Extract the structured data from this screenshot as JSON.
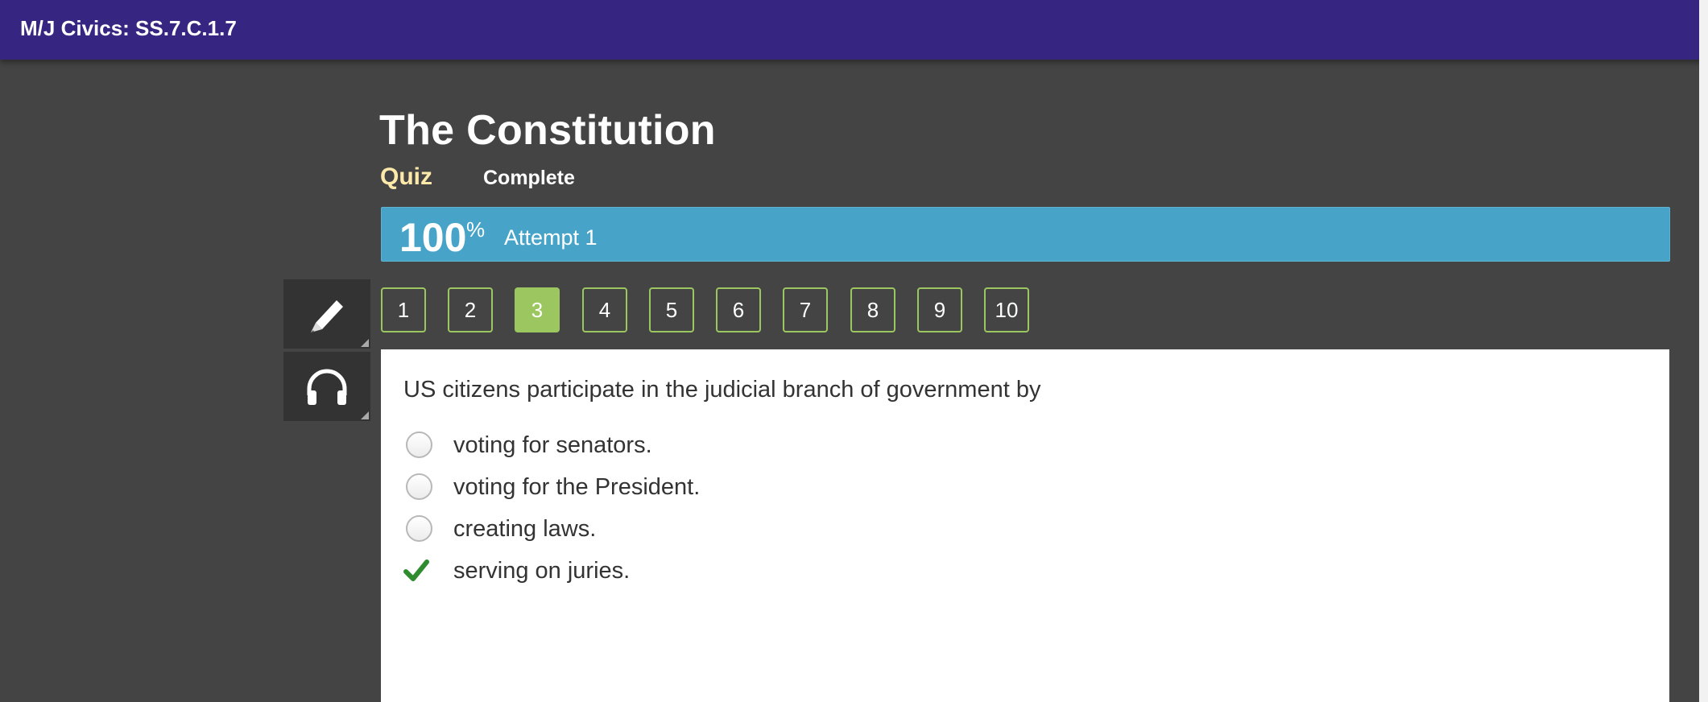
{
  "header": {
    "course": "M/J Civics: SS.7.C.1.7"
  },
  "lesson": {
    "title": "The Constitution",
    "type": "Quiz",
    "status": "Complete"
  },
  "score": {
    "value": "100",
    "unit": "%",
    "attempt": "Attempt 1"
  },
  "tools": [
    {
      "icon": "pencil-icon"
    },
    {
      "icon": "headphones-icon"
    }
  ],
  "question_nav": {
    "items": [
      "1",
      "2",
      "3",
      "4",
      "5",
      "6",
      "7",
      "8",
      "9",
      "10"
    ],
    "active": "3"
  },
  "question": {
    "text": "US citizens participate in the judicial branch of government by",
    "options": [
      {
        "label": "voting for senators.",
        "state": "unselected"
      },
      {
        "label": "voting for the President.",
        "state": "unselected"
      },
      {
        "label": "creating laws.",
        "state": "unselected"
      },
      {
        "label": "serving on juries.",
        "state": "correct"
      }
    ]
  },
  "colors": {
    "header_bg": "#372582",
    "page_bg": "#444444",
    "score_bar": "#47a4c8",
    "accent_green": "#9cc660",
    "quiz_label": "#fde9a9",
    "check_green": "#2e8b2e"
  }
}
